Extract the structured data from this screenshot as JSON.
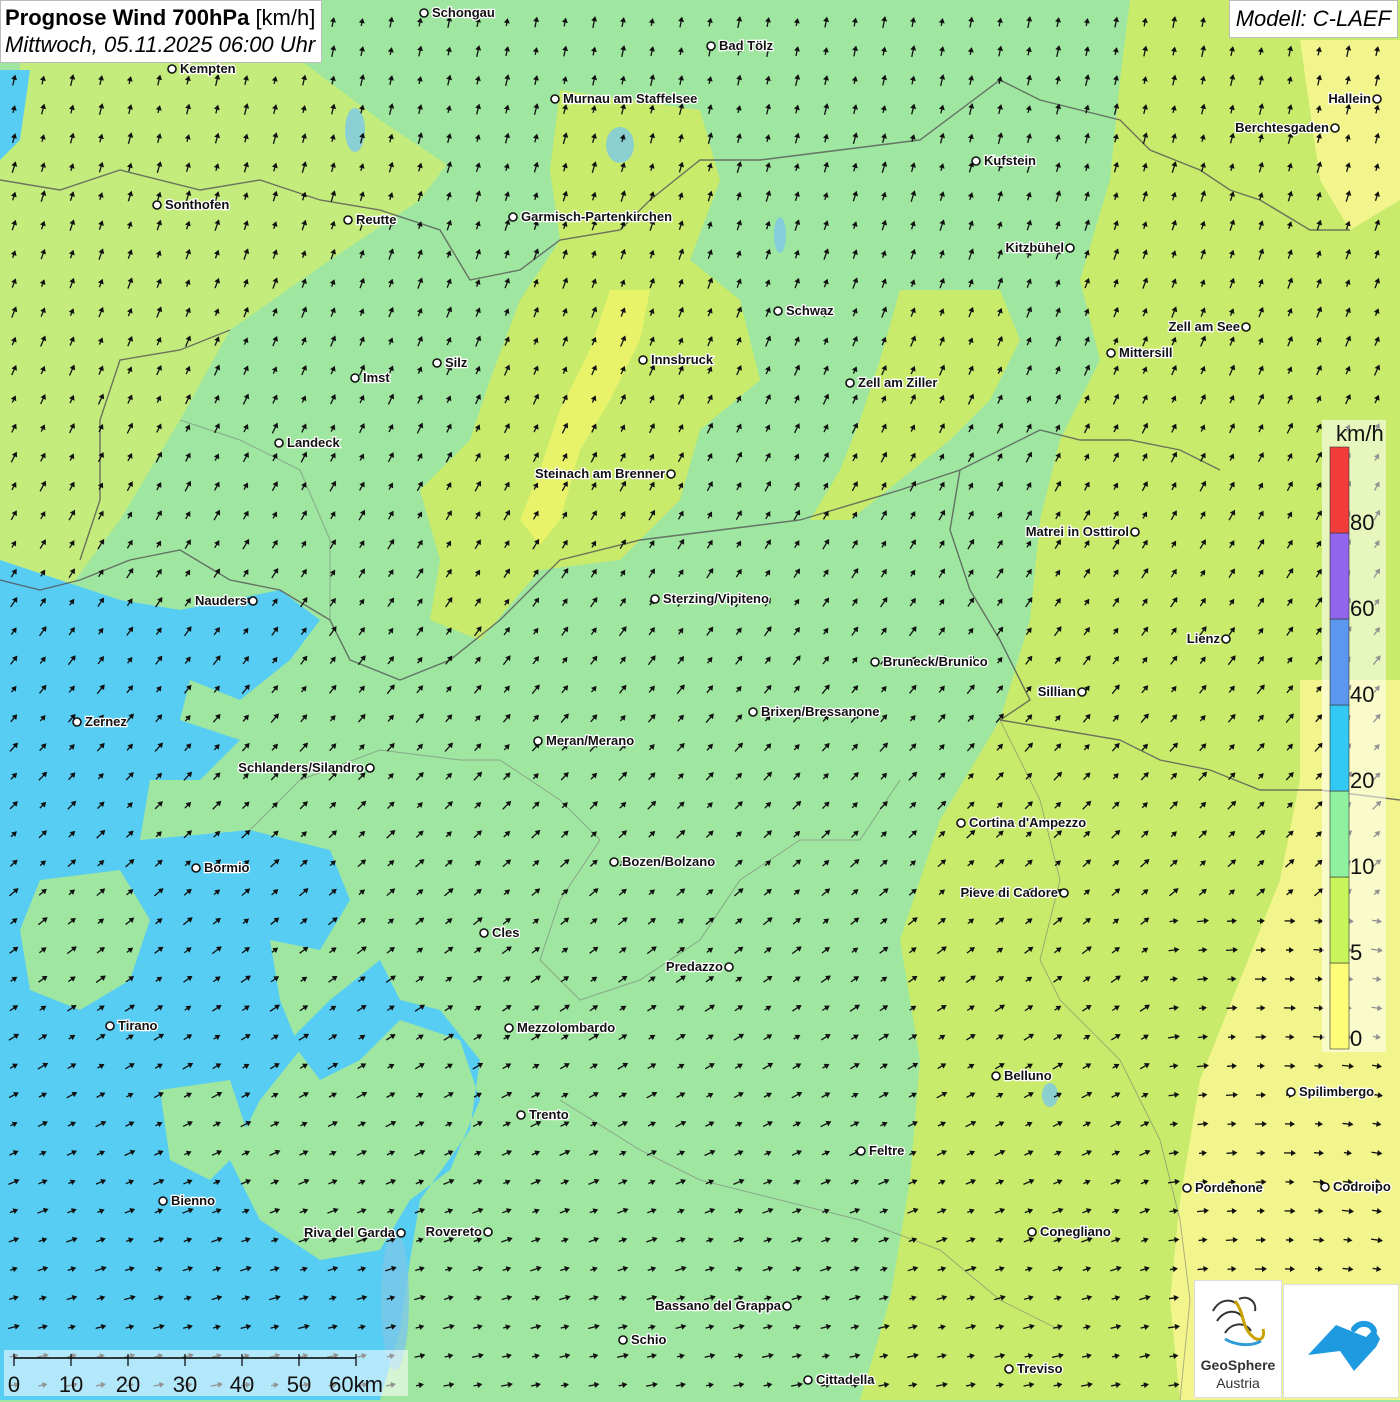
{
  "header": {
    "title": "Prognose Wind 700hPa",
    "unit": "[km/h]",
    "datetime": "Mittwoch, 05.11.2025 06:00 Uhr"
  },
  "model": "Modell: C-LAEF",
  "legend": {
    "unit": "km/h",
    "bands": [
      {
        "label": "0",
        "color": "#fdfd78"
      },
      {
        "label": "5",
        "color": "#c8f55a"
      },
      {
        "label": "10",
        "color": "#8ff0a0"
      },
      {
        "label": "20",
        "color": "#33c9f5"
      },
      {
        "label": "40",
        "color": "#5b97ee"
      },
      {
        "label": "60",
        "color": "#9166ec"
      },
      {
        "label": "80",
        "color": "#f23c3c"
      }
    ]
  },
  "scale_bar": {
    "labels": [
      "0",
      "10",
      "20",
      "30",
      "40",
      "50",
      "60km"
    ]
  },
  "cities": [
    {
      "name": "Schongau"
    },
    {
      "name": "Bad Tölz"
    },
    {
      "name": "Kempten"
    },
    {
      "name": "Murnau am Staffelsee"
    },
    {
      "name": "Hallein"
    },
    {
      "name": "Berchtesgaden"
    },
    {
      "name": "Kufstein"
    },
    {
      "name": "Sonthofen"
    },
    {
      "name": "Reutte"
    },
    {
      "name": "Garmisch-Partenkirchen"
    },
    {
      "name": "Kitzbühel"
    },
    {
      "name": "Schwaz"
    },
    {
      "name": "Zell am See"
    },
    {
      "name": "Mittersill"
    },
    {
      "name": "Innsbruck"
    },
    {
      "name": "Silz"
    },
    {
      "name": "Imst"
    },
    {
      "name": "Zell am Ziller"
    },
    {
      "name": "Landeck"
    },
    {
      "name": "Steinach am Brenner"
    },
    {
      "name": "Matrei in Osttirol"
    },
    {
      "name": "Nauders"
    },
    {
      "name": "Sterzing/Vipiteno"
    },
    {
      "name": "Lienz"
    },
    {
      "name": "Bruneck/Brunico"
    },
    {
      "name": "Sillian"
    },
    {
      "name": "Zernez"
    },
    {
      "name": "Brixen/Bressanone"
    },
    {
      "name": "Meran/Merano"
    },
    {
      "name": "Schlanders/Silandro"
    },
    {
      "name": "Cortina d'Ampezzo"
    },
    {
      "name": "Bormio"
    },
    {
      "name": "Bozen/Bolzano"
    },
    {
      "name": "Pieve di Cadore"
    },
    {
      "name": "Cles"
    },
    {
      "name": "Predazzo"
    },
    {
      "name": "Tirano"
    },
    {
      "name": "Mezzolombardo"
    },
    {
      "name": "Belluno"
    },
    {
      "name": "Spilimbergo"
    },
    {
      "name": "Trento"
    },
    {
      "name": "Feltre"
    },
    {
      "name": "Bienno"
    },
    {
      "name": "Pordenone"
    },
    {
      "name": "Codroipo"
    },
    {
      "name": "Riva del Garda"
    },
    {
      "name": "Rovereto"
    },
    {
      "name": "Conegliano"
    },
    {
      "name": "Bassano del Grappa"
    },
    {
      "name": "Schio"
    },
    {
      "name": "Treviso"
    },
    {
      "name": "Cittadella"
    }
  ],
  "logos": {
    "geosphere_line1": "GeoSphere",
    "geosphere_line2": "Austria"
  }
}
